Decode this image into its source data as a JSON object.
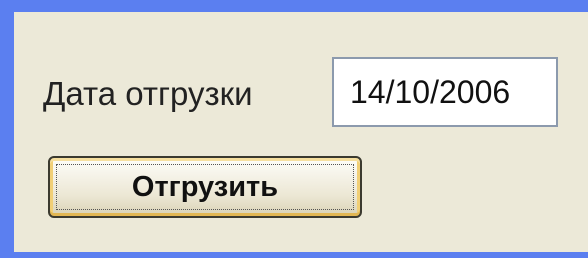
{
  "form": {
    "date_label": "Дата отгрузки",
    "date_value": "14/10/2006",
    "ship_button_label": "Отгрузить"
  },
  "colors": {
    "desktop_background": "#5b7ff0",
    "panel_background": "#ece9d8",
    "button_focus_highlight": "#e2b753"
  }
}
